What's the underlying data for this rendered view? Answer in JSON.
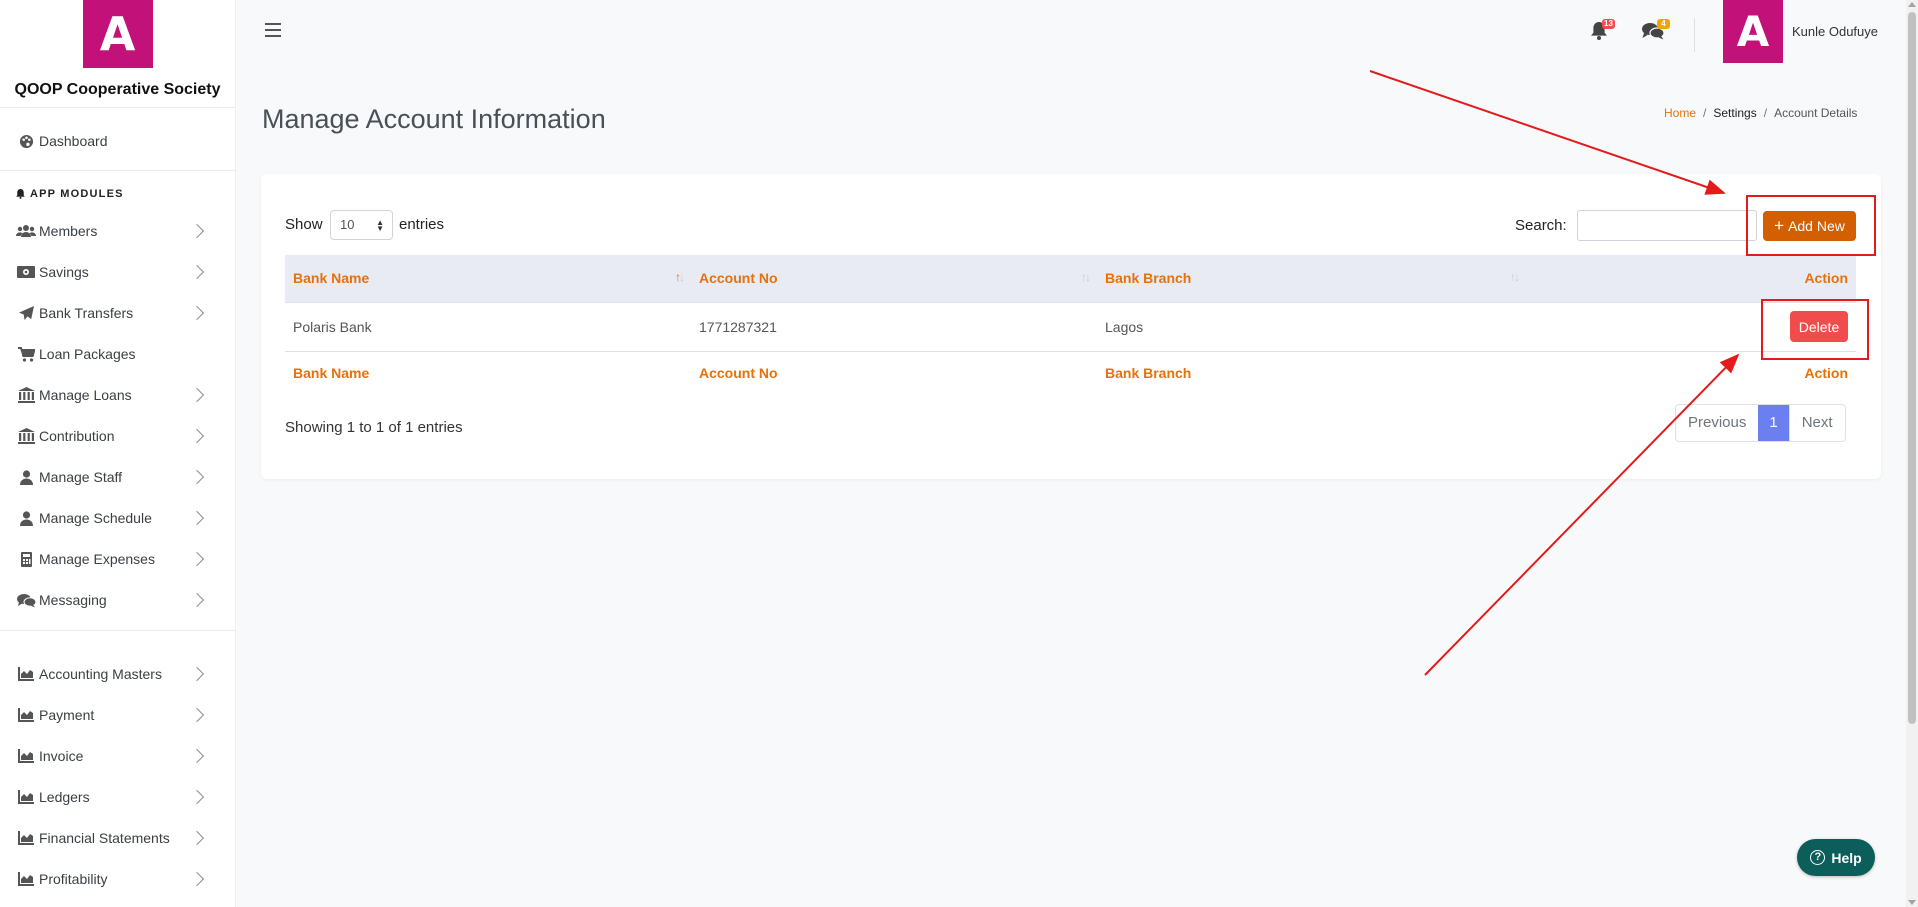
{
  "brand": {
    "logo_letter": "A",
    "name": "QOOP Cooperative Society",
    "color": "#c2127a"
  },
  "sidebar": {
    "dashboard": {
      "label": "Dashboard",
      "icon": "palette-icon"
    },
    "section_label": "APP MODULES",
    "modules": [
      {
        "label": "Members",
        "icon": "users-icon"
      },
      {
        "label": "Savings",
        "icon": "money-icon"
      },
      {
        "label": "Bank Transfers",
        "icon": "paper-plane-icon"
      },
      {
        "label": "Loan Packages",
        "icon": "cart-icon"
      },
      {
        "label": "Manage Loans",
        "icon": "bank-icon"
      },
      {
        "label": "Contribution",
        "icon": "bank-icon"
      },
      {
        "label": "Manage Staff",
        "icon": "user-icon"
      },
      {
        "label": "Manage Schedule",
        "icon": "user-icon"
      },
      {
        "label": "Manage Expenses",
        "icon": "calculator-icon"
      },
      {
        "label": "Messaging",
        "icon": "comments-icon"
      }
    ],
    "accounting": [
      {
        "label": "Accounting Masters",
        "icon": "chart-area-icon"
      },
      {
        "label": "Payment",
        "icon": "chart-area-icon"
      },
      {
        "label": "Invoice",
        "icon": "chart-area-icon"
      },
      {
        "label": "Ledgers",
        "icon": "chart-area-icon"
      },
      {
        "label": "Financial Statements",
        "icon": "chart-area-icon"
      },
      {
        "label": "Profitability",
        "icon": "chart-area-icon"
      }
    ]
  },
  "topbar": {
    "notifications_count": "13",
    "messages_count": "4",
    "user_avatar_letter": "A",
    "user_name": "Kunle Odufuye"
  },
  "page": {
    "title": "Manage Account Information",
    "breadcrumb": {
      "home": "Home",
      "settings": "Settings",
      "current": "Account Details",
      "sep": "/"
    }
  },
  "table_controls": {
    "show_label": "Show",
    "entries_value": "10",
    "entries_label": "entries",
    "search_label": "Search:",
    "search_value": "",
    "add_new_label": "Add New"
  },
  "table": {
    "columns": [
      "Bank Name",
      "Account No",
      "Bank Branch",
      "Action"
    ],
    "rows": [
      {
        "bank_name": "Polaris Bank",
        "account_no": "1771287321",
        "bank_branch": "Lagos",
        "action": "Delete"
      }
    ],
    "footer_columns": [
      "Bank Name",
      "Account No",
      "Bank Branch",
      "Action"
    ],
    "info": "Showing 1 to 1 of 1 entries",
    "pagination": {
      "previous": "Previous",
      "current_page": "1",
      "next": "Next"
    }
  },
  "help_button": {
    "label": "Help"
  },
  "colors": {
    "accent": "#e8710a",
    "add_button": "#d35f00",
    "delete_button": "#f14c4c",
    "page_active": "#6b7ff0",
    "annotation": "#e31b1b",
    "help": "#0c5e5a"
  }
}
